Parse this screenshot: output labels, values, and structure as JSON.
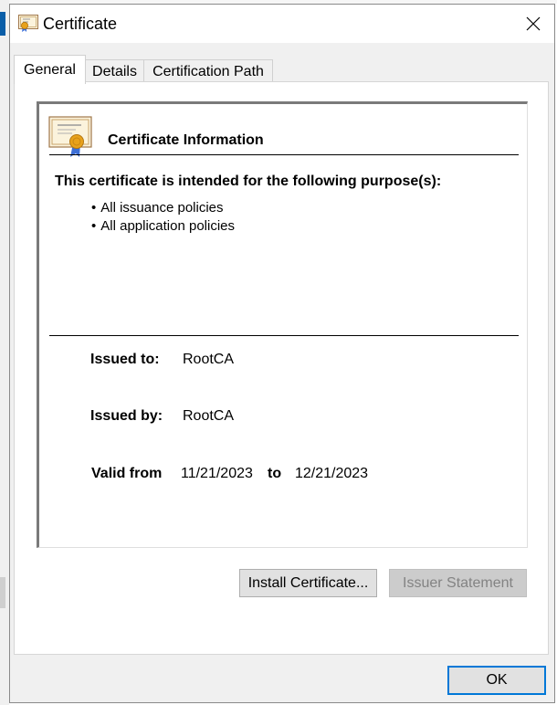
{
  "window": {
    "title": "Certificate"
  },
  "tabs": [
    {
      "label": "General",
      "active": true
    },
    {
      "label": "Details",
      "active": false
    },
    {
      "label": "Certification Path",
      "active": false
    }
  ],
  "general": {
    "info_title": "Certificate Information",
    "purpose_heading": "This certificate is intended for the following purpose(s):",
    "purposes": [
      "All issuance policies",
      "All application policies"
    ],
    "issued_to_label": "Issued to:",
    "issued_to_value": "RootCA",
    "issued_by_label": "Issued by:",
    "issued_by_value": "RootCA",
    "valid_from_label": "Valid from",
    "valid_from_value": "11/21/2023",
    "valid_to_label": "to",
    "valid_to_value": "12/21/2023"
  },
  "buttons": {
    "install": "Install Certificate...",
    "issuer_statement": "Issuer Statement",
    "ok": "OK"
  },
  "colors": {
    "accent": "#0078d7",
    "dialog_bg": "#f0f0f0",
    "seal": "#e8a21b"
  },
  "icons": {
    "title": "certificate-icon",
    "close": "close-icon",
    "info": "certificate-icon"
  }
}
